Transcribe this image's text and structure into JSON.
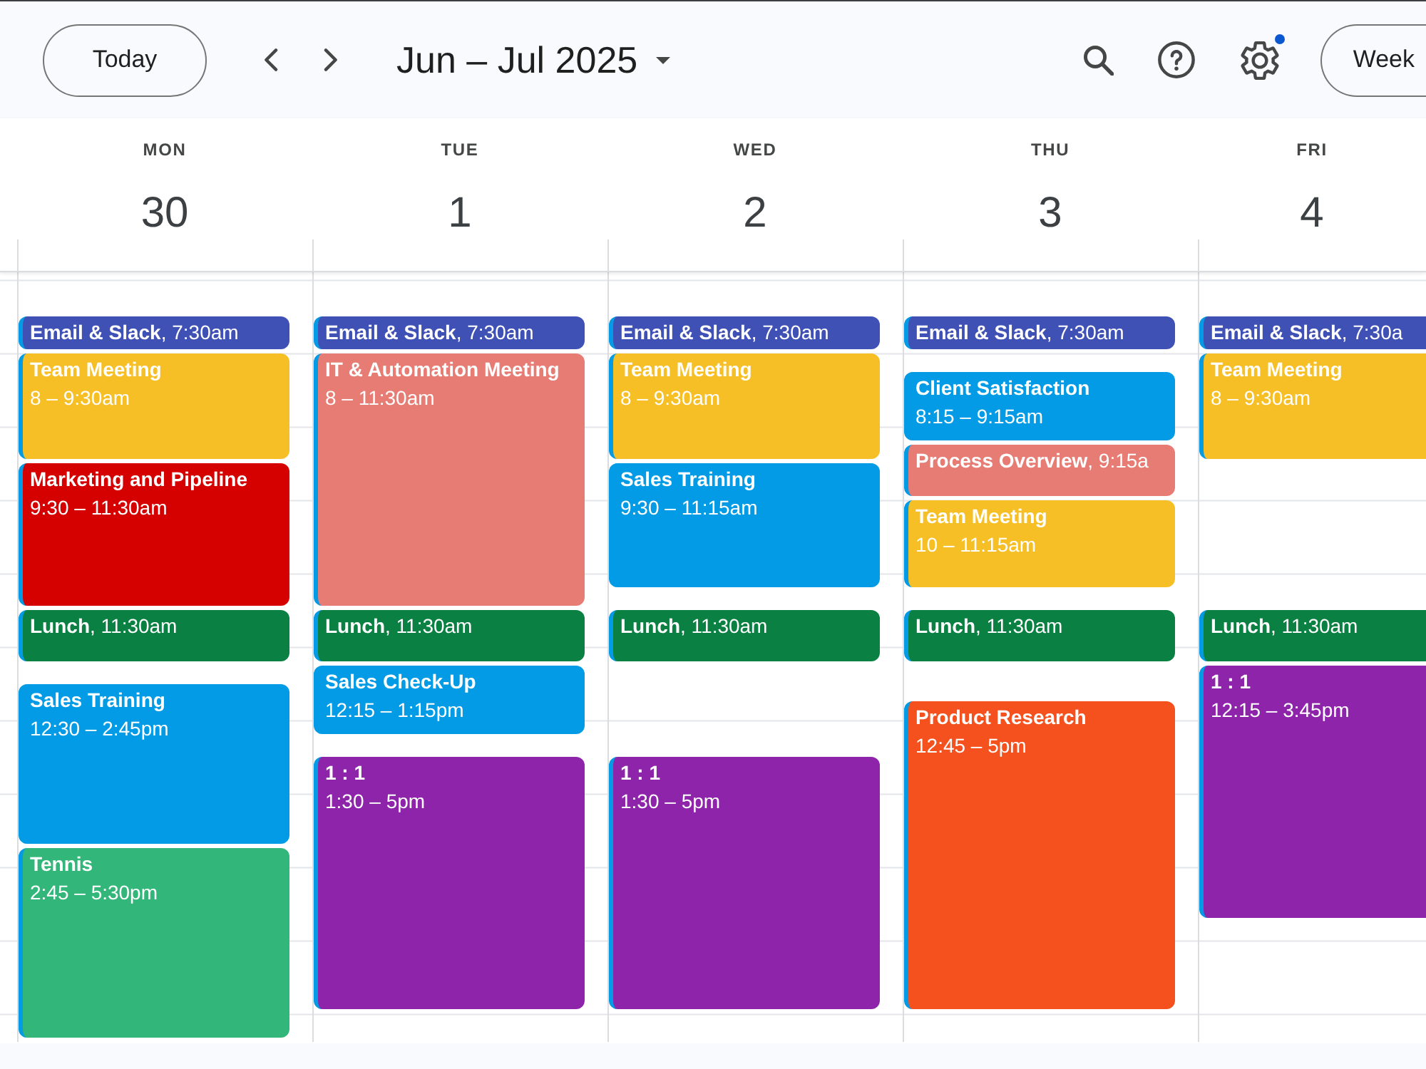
{
  "toolbar": {
    "today_button": "Today",
    "date_range": "Jun – Jul 2025",
    "settings_badge": true,
    "view_button": "Week"
  },
  "days": [
    {
      "weekday": "MON",
      "date": "30",
      "events": [
        {
          "kind": "compact",
          "label": "**Email & Slack**, 7:30am",
          "color": "#3f51b5"
        },
        {
          "kind": "full",
          "title": "Team Meeting",
          "time": "8 – 9:30am",
          "color": "#f6bf26"
        },
        {
          "kind": "full",
          "title": "Marketing and Pipeline",
          "time": "9:30 – 11:30am",
          "color": "#d50000"
        },
        {
          "kind": "compact",
          "label": "**Lunch**, 11:30am",
          "color": "#0b8043"
        },
        {
          "kind": "full",
          "title": "Sales Training",
          "time": "12:30 – 2:45pm",
          "color": "#039be5"
        },
        {
          "kind": "full",
          "title": "Tennis",
          "time": "2:45 – 5:30pm",
          "color": "#33b679"
        }
      ]
    },
    {
      "weekday": "TUE",
      "date": "1",
      "events": [
        {
          "kind": "compact",
          "label": "**Email & Slack**, 7:30am",
          "color": "#3f51b5"
        },
        {
          "kind": "full",
          "title": "IT & Automation Meeting",
          "time": "8 – 11:30am",
          "color": "#e67c73"
        },
        {
          "kind": "compact",
          "label": "**Lunch**, 11:30am",
          "color": "#0b8043"
        },
        {
          "kind": "full",
          "title": "Sales Check-Up",
          "time": "12:15 – 1:15pm",
          "color": "#039be5"
        },
        {
          "kind": "full",
          "title": "1 : 1",
          "time": "1:30 – 5pm",
          "color": "#8e24aa"
        }
      ]
    },
    {
      "weekday": "WED",
      "date": "2",
      "events": [
        {
          "kind": "compact",
          "label": "**Email & Slack**, 7:30am",
          "color": "#3f51b5"
        },
        {
          "kind": "full",
          "title": "Team Meeting",
          "time": "8 – 9:30am",
          "color": "#f6bf26"
        },
        {
          "kind": "full",
          "title": "Sales Training",
          "time": "9:30 – 11:15am",
          "color": "#039be5"
        },
        {
          "kind": "compact",
          "label": "**Lunch**, 11:30am",
          "color": "#0b8043"
        },
        {
          "kind": "full",
          "title": "1 : 1",
          "time": "1:30 – 5pm",
          "color": "#8e24aa"
        }
      ]
    },
    {
      "weekday": "THU",
      "date": "3",
      "events": [
        {
          "kind": "compact",
          "label": "**Email & Slack**, 7:30am",
          "color": "#3f51b5"
        },
        {
          "kind": "full",
          "title": "Client Satisfaction",
          "time": "8:15 – 9:15am",
          "color": "#039be5"
        },
        {
          "kind": "compact",
          "label": "**Process Overview**, 9:15a",
          "color": "#e67c73"
        },
        {
          "kind": "full",
          "title": "Team Meeting",
          "time": "10 – 11:15am",
          "color": "#f6bf26"
        },
        {
          "kind": "compact",
          "label": "**Lunch**, 11:30am",
          "color": "#0b8043"
        },
        {
          "kind": "full",
          "title": "Product Research",
          "time": "12:45 – 5pm",
          "color": "#f4511e"
        }
      ]
    },
    {
      "weekday": "FRI",
      "date": "4",
      "events": [
        {
          "kind": "compact",
          "label": "**Email & Slack**, 7:30a",
          "color": "#3f51b5"
        },
        {
          "kind": "full",
          "title": "Team Meeting",
          "time": "8 – 9:30am",
          "color": "#f6bf26"
        },
        {
          "kind": "compact",
          "label": "**Lunch**, 11:30am",
          "color": "#0b8043"
        },
        {
          "kind": "full",
          "title": "1 : 1",
          "time": "12:15 – 3:45pm",
          "color": "#8e24aa"
        }
      ]
    }
  ]
}
